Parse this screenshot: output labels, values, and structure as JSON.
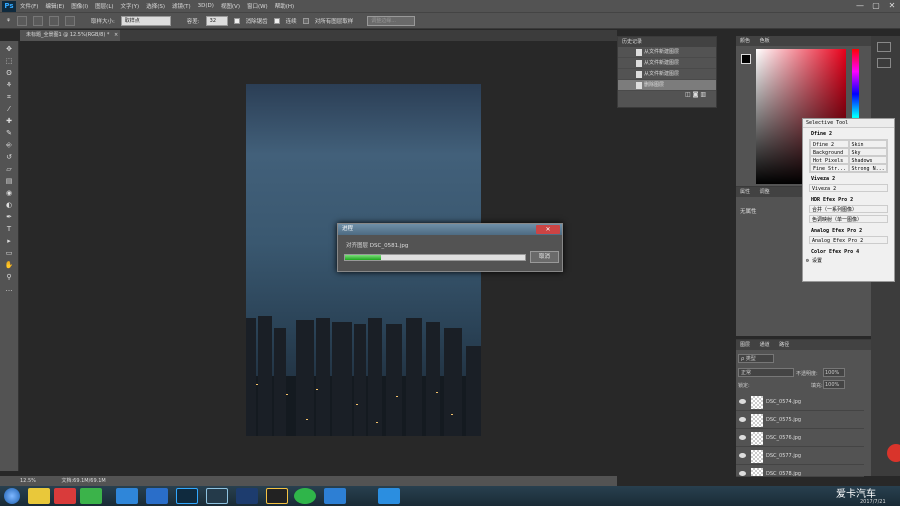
{
  "app": {
    "logo": "Ps",
    "menu": [
      "文件(F)",
      "编辑(E)",
      "图像(I)",
      "图层(L)",
      "文字(Y)",
      "选择(S)",
      "滤镜(T)",
      "3D(D)",
      "视图(V)",
      "窗口(W)",
      "帮助(H)"
    ],
    "window_controls": {
      "minimize": "—",
      "maximize": "▢",
      "close": "✕"
    }
  },
  "options_bar": {
    "sample_size_label": "取样大小:",
    "sample_size_value": "取样点",
    "tolerance_label": "容差:",
    "tolerance_value": "32",
    "antialias_label": "消除锯齿",
    "contiguous_label": "连续",
    "all_layers_label": "对所有图层取样",
    "refine_edge_label": "调整边缘..."
  },
  "document": {
    "tab_title": "未标题_全景图1 @ 12.5%(RGB/8) *",
    "tab_close": "×"
  },
  "toolbar": {
    "tools": [
      "move-icon",
      "marquee-icon",
      "lasso-icon",
      "magic-wand-icon",
      "crop-icon",
      "eyedropper-icon",
      "heal-icon",
      "brush-icon",
      "stamp-icon",
      "history-brush-icon",
      "eraser-icon",
      "gradient-icon",
      "blur-icon",
      "dodge-icon",
      "pen-icon",
      "type-icon",
      "path-select-icon",
      "shape-icon",
      "hand-icon",
      "zoom-icon",
      "more-icon"
    ],
    "tool_glyphs": [
      "✥",
      "⬚",
      "ʘ",
      "⚘",
      "⌗",
      "⁄",
      "✚",
      "✎",
      "⎆",
      "↺",
      "▱",
      "▤",
      "◉",
      "◐",
      "✒",
      "T",
      "▸",
      "▭",
      "✋",
      "⚲",
      "…"
    ]
  },
  "progress_dialog": {
    "title": "进程",
    "close": "✕",
    "message": "对齐图层 DSC_0581.jpg",
    "progress": 0.2,
    "cancel_label": "取消"
  },
  "history_panel": {
    "tab": "历史记录",
    "items": [
      {
        "label": "从文件新建图层",
        "active": false
      },
      {
        "label": "从文件新建图层",
        "active": false
      },
      {
        "label": "从文件新建图层",
        "active": false
      },
      {
        "label": "删除图层",
        "active": true
      }
    ]
  },
  "color_panel": {
    "tabs": [
      "颜色",
      "色板"
    ],
    "foreground": "#000000",
    "background": "#ffffff",
    "hue_color": "#e8001a"
  },
  "properties_panel": {
    "tabs": [
      "属性",
      "调整"
    ],
    "text": "无属性"
  },
  "layers_panel": {
    "tabs": [
      "图层",
      "通道",
      "路径"
    ],
    "filter_label": "ρ 类型",
    "blend_mode": "正常",
    "opacity_label": "不透明度:",
    "opacity_value": "100%",
    "lock_label": "锁定:",
    "fill_label": "填充:",
    "fill_value": "100%",
    "layers": [
      "DSC_0574.jpg",
      "DSC_0575.jpg",
      "DSC_0576.jpg",
      "DSC_0577.jpg",
      "DSC_0578.jpg"
    ]
  },
  "selective_tool": {
    "title": "Selective Tool",
    "sections": [
      {
        "heading": "Dfine 2",
        "grid": [
          "Dfine 2",
          "Skin",
          "Background",
          "Sky",
          "Hot Pixels",
          "Shadows",
          "Fine Str...",
          "Strong N..."
        ]
      },
      {
        "heading": "Viveza 2",
        "buttons": [
          "Viveza 2"
        ]
      },
      {
        "heading": "HDR Efex Pro 2",
        "buttons": [
          "合并（一系列图像）",
          "色调映射（单一图像）"
        ]
      },
      {
        "heading": "Analog Efex Pro 2",
        "buttons": [
          "Analog Efex Pro 2"
        ]
      },
      {
        "heading": "Color Efex Pro 4",
        "buttons": []
      }
    ],
    "settings": "设置"
  },
  "status_bar": {
    "zoom": "12.5%",
    "doc_info": "文档:69.1M/69.1M"
  },
  "taskbar": {
    "clock_date": "2017/7/21",
    "icons": [
      "start-icon",
      "browser-icon",
      "media-icon",
      "game-icon",
      "tool-icon",
      "player-icon",
      "photoshop-icon",
      "lightroom-icon",
      "monitor-icon",
      "qq-icon",
      "wechat-icon",
      "bird-icon",
      "word-icon"
    ]
  },
  "badge_text": "",
  "watermark": "爱卡汽车"
}
